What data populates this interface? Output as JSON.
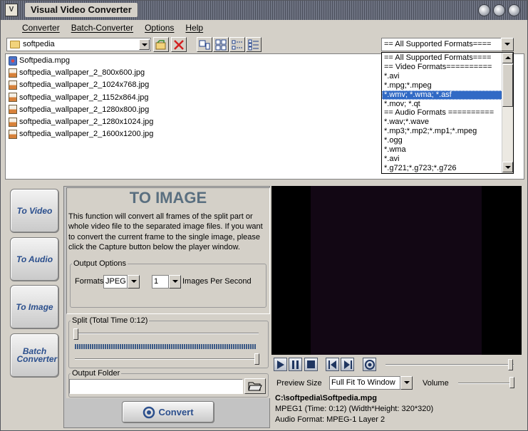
{
  "app": {
    "title": "Visual Video Converter"
  },
  "menu": [
    "Converter",
    "Batch-Converter",
    "Options",
    "Help"
  ],
  "toolbar": {
    "path": "softpedia",
    "format_filter": "== All Supported Formats===="
  },
  "files": [
    {
      "name": "Softpedia.mpg",
      "type": "mpg"
    },
    {
      "name": "softpedia_wallpaper_2_800x600.jpg",
      "type": "jpg"
    },
    {
      "name": "softpedia_wallpaper_2_1024x768.jpg",
      "type": "jpg"
    },
    {
      "name": "softpedia_wallpaper_2_1152x864.jpg",
      "type": "jpg"
    },
    {
      "name": "softpedia_wallpaper_2_1280x800.jpg",
      "type": "jpg"
    },
    {
      "name": "softpedia_wallpaper_2_1280x1024.jpg",
      "type": "jpg"
    },
    {
      "name": "softpedia_wallpaper_2_1600x1200.jpg",
      "type": "jpg"
    }
  ],
  "format_options": [
    "== All Supported Formats====",
    "== Video Formats==========",
    "*.avi",
    "*.mpg;*.mpeg",
    "*.wmv; *.wma; *.asf",
    "*.mov; *.qt",
    "== Audio Formats ==========",
    "*.wav;*.wave",
    "*.mp3;*.mp2;*.mp1;*.mpeg",
    "*.ogg",
    "*.wma",
    "*.avi",
    "*.g721;*.g723;*.g726"
  ],
  "format_selected_index": 4,
  "nav": [
    "To Video",
    "To Audio",
    "To Image",
    "Batch Converter"
  ],
  "panel": {
    "heading": "TO IMAGE",
    "description": "This function will convert all frames of the split part or whole video file to the separated image files. If you want to convert the current frame to the single image, please click the Capture button below the player window.",
    "output_options_label": "Output Options",
    "formats_label": "Formats",
    "format_value": "JPEG",
    "images_per_second_value": "1",
    "images_per_second_label": "Images Per Second",
    "split_label": "Split  (Total Time 0:12)",
    "output_folder_label": "Output Folder",
    "output_folder_value": "",
    "convert_label": "Convert"
  },
  "player": {
    "preview_size_label": "Preview Size",
    "preview_size_value": "Full Fit To Window",
    "volume_label": "Volume",
    "status_file": "C:\\softpedia\\Softpedia.mpg",
    "status_video": "MPEG1 (Time: 0:12) (Width*Height: 320*320)",
    "status_audio": "Audio Format: MPEG-1 Layer 2"
  },
  "icons": {
    "window": "app-icon",
    "minimize": "minimize-icon",
    "maximize": "maximize-icon",
    "close": "close-icon"
  }
}
